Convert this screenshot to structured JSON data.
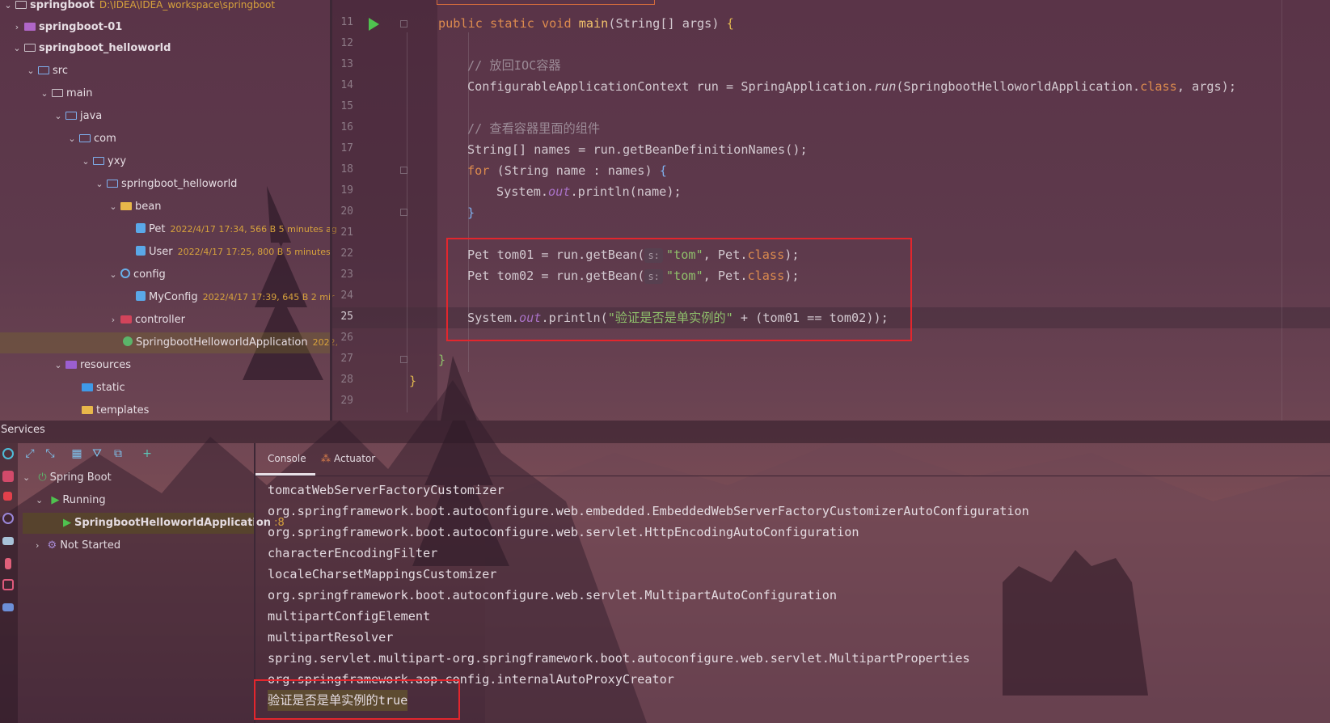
{
  "project": {
    "root_label": "springboot",
    "root_path": "D:\\IDEA\\IDEA_workspace\\springboot",
    "items": [
      {
        "label": "springboot-01"
      },
      {
        "label": "springboot_helloworld"
      },
      {
        "label": "src"
      },
      {
        "label": "main"
      },
      {
        "label": "java"
      },
      {
        "label": "com"
      },
      {
        "label": "yxy"
      },
      {
        "label": "springboot_helloworld"
      },
      {
        "label": "bean"
      },
      {
        "label": "Pet",
        "meta": "2022/4/17 17:34, 566 B 5 minutes ag"
      },
      {
        "label": "User",
        "meta": "2022/4/17 17:25, 800 B 5 minutes"
      },
      {
        "label": "config"
      },
      {
        "label": "MyConfig",
        "meta": "2022/4/17 17:39, 645 B 2 mir"
      },
      {
        "label": "controller"
      },
      {
        "label": "SpringbootHelloworldApplication",
        "meta": "2022,"
      },
      {
        "label": "resources"
      },
      {
        "label": "static"
      },
      {
        "label": "templates"
      }
    ]
  },
  "editor": {
    "line_numbers": [
      "11",
      "12",
      "13",
      "14",
      "15",
      "16",
      "17",
      "18",
      "19",
      "20",
      "21",
      "22",
      "23",
      "24",
      "25",
      "26",
      "27",
      "28",
      "29"
    ],
    "current_line": "25",
    "code": {
      "l11_kw": "public static void ",
      "l11_fn": "main",
      "l11_rest": "(String[] args) ",
      "l11_brace": "{",
      "l13": "// 放回IOC容器",
      "l14_a": "ConfigurableApplicationContext run = SpringApplication.",
      "l14_run": "run",
      "l14_b": "(SpringbootHelloworldApplication.",
      "l14_class": "class",
      "l14_c": ", args);",
      "l16": "// 查看容器里面的组件",
      "l17": "String[] names = run.getBeanDefinitionNames();",
      "l18_kw": "for ",
      "l18_rest": "(String name : names) ",
      "l18_brace": "{",
      "l19_a": "System.",
      "l19_out": "out",
      "l19_b": ".println(name);",
      "l20": "}",
      "l22_a": "Pet tom01 = run.getBean(",
      "hint": "s:",
      "l22_str": "\"tom\"",
      "l22_b": ", Pet.",
      "l22_class": "class",
      "l22_c": ");",
      "l23_a": "Pet tom02 = run.getBean(",
      "l23_str": "\"tom\"",
      "l23_b": ", Pet.",
      "l23_class": "class",
      "l23_c": ");",
      "l25_a": "System.",
      "l25_out": "out",
      "l25_b": ".println(",
      "l25_str": "\"验证是否是单实例的\"",
      "l25_c": " + (tom01 == tom02));",
      "l27": "}",
      "l28": "}"
    }
  },
  "services": {
    "title": "Services",
    "tree": [
      {
        "label": "Spring Boot"
      },
      {
        "label": "Running"
      },
      {
        "label": "SpringbootHelloworldApplication",
        "suffix": ":8"
      },
      {
        "label": "Not Started"
      }
    ]
  },
  "console": {
    "tabs": [
      "Console",
      "Actuator"
    ],
    "lines": [
      "tomcatWebServerFactoryCustomizer",
      "org.springframework.boot.autoconfigure.web.embedded.EmbeddedWebServerFactoryCustomizerAutoConfiguration",
      "org.springframework.boot.autoconfigure.web.servlet.HttpEncodingAutoConfiguration",
      "characterEncodingFilter",
      "localeCharsetMappingsCustomizer",
      "org.springframework.boot.autoconfigure.web.servlet.MultipartAutoConfiguration",
      "multipartConfigElement",
      "multipartResolver",
      "spring.servlet.multipart-org.springframework.boot.autoconfigure.web.servlet.MultipartProperties",
      "org.springframework.aop.config.internalAutoProxyCreator"
    ],
    "result": "验证是否是单实例的true"
  },
  "colors": {
    "highlight_box": "#e3262d",
    "run_marker": "#4fc24f",
    "keyword": "#dc8b4e",
    "string": "#8fbf6b"
  }
}
